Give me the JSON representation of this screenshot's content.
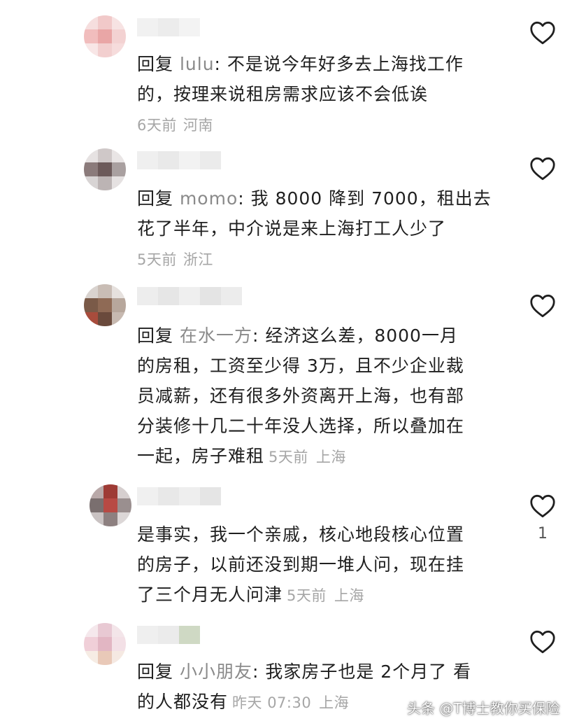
{
  "comments": [
    {
      "reply_prefix": "回复 ",
      "reply_to": "lulu",
      "sep": ": ",
      "text_line1": "不是说今年好多去上海找工作",
      "text_line2": "的，按理来说租房需求应该不会低诶",
      "time": "6天前",
      "location": "河南",
      "avatar_colors": [
        "#f6dede",
        "#f1c9c9",
        "#f7e3e3",
        "#f1bdbd",
        "#e9a6a6",
        "#f3d2d2",
        "#f8e6e6",
        "#f2cfcf",
        "#f6dcdc"
      ],
      "nick_colors": [
        "#f1f1f1",
        "#ececec",
        "#f3f3f3"
      ]
    },
    {
      "reply_prefix": "回复 ",
      "reply_to": "momo",
      "sep": ": ",
      "text_line1": "我 8000 降到 7000，租出去",
      "text_line2": "花了半年，中介说是来上海打工人少了",
      "time": "5天前",
      "location": "浙江",
      "avatar_colors": [
        "#e6e2e2",
        "#cfc8c8",
        "#e9e5e5",
        "#8b7b7b",
        "#6c5a5a",
        "#a9a0a0",
        "#d8d4d4",
        "#bcb4b4",
        "#e5e1e1"
      ],
      "nick_colors": [
        "#efefef",
        "#e9e9e9",
        "#f2f2f2",
        "#ebebeb"
      ]
    },
    {
      "reply_prefix": "回复 ",
      "reply_to": "在水一方",
      "sep": ": ",
      "text_line1": "经济这么差，8000一月",
      "text_line2": "的房租，工资至少得 3万，且不少企业裁",
      "text_line3": "员减薪，还有很多外资离开上海，也有部",
      "text_line4": "分装修十几二十年没人选择，所以叠加在",
      "text_line5": "一起，房子难租",
      "time": "5天前",
      "location": "上海",
      "avatar_colors": [
        "#d9d3cf",
        "#c9bdb5",
        "#e6e1de",
        "#7a5a48",
        "#8f6a55",
        "#b7a79c",
        "#a84c3c",
        "#6a4a3c",
        "#c7b9b0"
      ],
      "nick_colors": [
        "#ededed",
        "#e6e6e6",
        "#efefef",
        "#e4e4e4",
        "#ececec"
      ]
    },
    {
      "text_line1": "是事实，我一个亲戚，核心地段核心位置",
      "text_line2": "的房子，以前还没到期一堆人问，现在挂",
      "text_line3": "了三个月无人问津",
      "time": "5天前",
      "location": "上海",
      "like_count": "1",
      "avatar_colors": [
        "#b9a9a9",
        "#9e3b35",
        "#d6cfcf",
        "#7a6f6f",
        "#b84a44",
        "#9a8f8f",
        "#c9c2c2",
        "#8d8080",
        "#dcd7d7"
      ],
      "nick_colors": [
        "#f0f0f0",
        "#e8e8e8",
        "#eeeeee",
        "#e5e5e5"
      ]
    },
    {
      "reply_prefix": "回复 ",
      "reply_to": "小小朋友",
      "sep": ": ",
      "text_line1": "我家房子也是 2个月了 看",
      "text_line2": "的人都没有",
      "time": "昨天 07:30",
      "location": "上海",
      "avatar_colors": [
        "#f5e8ec",
        "#e8c9d3",
        "#f3e5e9",
        "#f0cfd8",
        "#e2b6c3",
        "#f3e0e6",
        "#f6ece4",
        "#e9c9b8",
        "#f5e9e2"
      ],
      "nick_colors": [
        "#efefef",
        "#ebebeb",
        "#cfd9c4"
      ]
    }
  ],
  "watermark": "头条 @T博士教你买保险"
}
